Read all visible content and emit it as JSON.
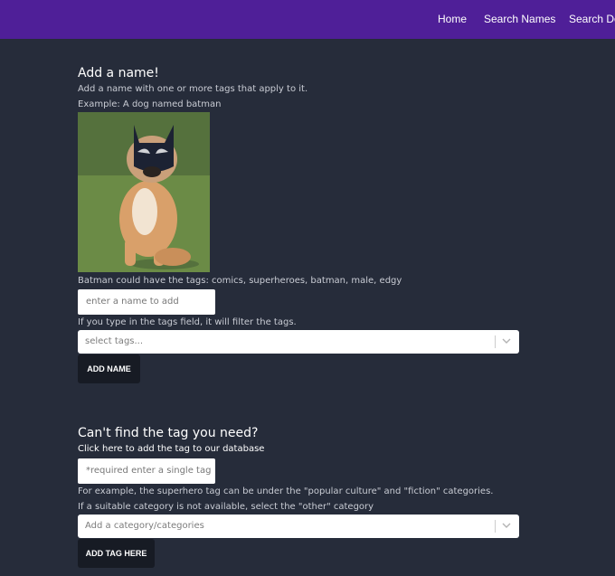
{
  "nav": {
    "links": [
      "Home",
      "Search Names",
      "Search De"
    ]
  },
  "add_name": {
    "heading": "Add a name!",
    "description": "Add a name with one or more tags that apply to it.",
    "example_label": "Example: A dog named batman",
    "example_tags": "Batman could have the tags: comics, superheroes, batman, male, edgy",
    "name_placeholder": "enter a name to add",
    "filter_hint": "If you type in the tags field, it will filter the tags.",
    "tags_placeholder": "select tags...",
    "button_label": "ADD NAME"
  },
  "add_tag": {
    "heading": "Can't find the tag you need?",
    "subheading": "Click here to add the tag to our database",
    "tag_placeholder": "*required enter a single tag",
    "example_text": "For example, the superhero tag can be under the \"popular culture\" and \"fiction\" categories.",
    "other_hint": "If a suitable category is not available, select the \"other\" category",
    "category_placeholder": "Add a category/categories",
    "button_label": "ADD TAG HERE"
  },
  "colors": {
    "navbar": "#4f1f98",
    "background": "#262c3a",
    "button": "#171b24"
  }
}
